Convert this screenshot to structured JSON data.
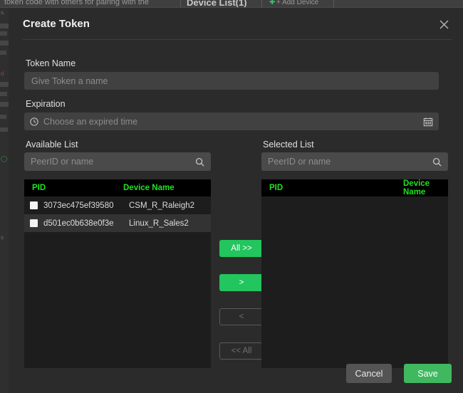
{
  "background": {
    "top_text": "token code with others for pairing with the",
    "top_title": "Device List(1)",
    "top_action": "+ Add Device",
    "strip_lines": [
      "s.",
      "d",
      "s"
    ]
  },
  "modal": {
    "title": "Create Token",
    "close_icon": "close-icon",
    "fields": {
      "token_name": {
        "label": "Token Name",
        "placeholder": "Give Token a name",
        "value": ""
      },
      "expiration": {
        "label": "Expiration",
        "placeholder": "Choose an expired time",
        "value": "",
        "leading_icon": "clock-icon",
        "trailing_icon": "calendar-icon"
      }
    },
    "available_list": {
      "title": "Available List",
      "search_placeholder": "PeerID or name",
      "search_value": "",
      "search_icon": "search-icon",
      "columns": [
        "PID",
        "Device Name"
      ],
      "rows": [
        {
          "pid": "3073ec475ef39580",
          "device_name": "CSM_R_Raleigh2",
          "checked": false
        },
        {
          "pid": "d501ec0b638e0f3e",
          "device_name": "Linux_R_Sales2",
          "checked": false
        }
      ]
    },
    "selected_list": {
      "title": "Selected List",
      "search_placeholder": "PeerID or name",
      "search_value": "",
      "search_icon": "search-icon",
      "columns": [
        "PID",
        "Device Name"
      ],
      "rows": []
    },
    "transfer_buttons": [
      {
        "label": "All >>",
        "enabled": true
      },
      {
        "label": ">",
        "enabled": true
      },
      {
        "label": "<",
        "enabled": false
      },
      {
        "label": "<< All",
        "enabled": false
      }
    ],
    "footer": {
      "cancel_label": "Cancel",
      "save_label": "Save"
    }
  },
  "colors": {
    "accent_green": "#22c55e",
    "save_green": "#3fb860",
    "header_green": "#1fe21f",
    "modal_bg": "#2b2b2b",
    "panel_bg": "#1d1d1d",
    "input_bg": "#414141"
  }
}
